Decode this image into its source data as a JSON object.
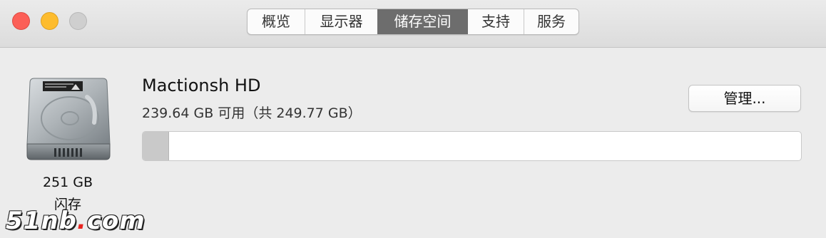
{
  "window": {
    "traffic_lights": [
      "close",
      "minimize",
      "zoom"
    ]
  },
  "tabs": [
    {
      "label": "概览",
      "active": false
    },
    {
      "label": "显示器",
      "active": false
    },
    {
      "label": "储存空间",
      "active": true
    },
    {
      "label": "支持",
      "active": false
    },
    {
      "label": "服务",
      "active": false
    }
  ],
  "disk": {
    "icon": "hard-drive-icon",
    "size": "251 GB",
    "type": "闪存"
  },
  "volume": {
    "name": "Mactionsh HD",
    "available": "239.64 GB 可用（共 249.77 GB）",
    "used_fraction": 0.04
  },
  "manage_button": {
    "label": "管理..."
  },
  "watermark": {
    "text_before": "51nb",
    "dot": ".",
    "text_after": "com"
  },
  "colors": {
    "active_tab": "#6d6d6d",
    "close": "#fc5f57",
    "minimize": "#fdbc2e",
    "zoom": "#cfcfcf"
  }
}
